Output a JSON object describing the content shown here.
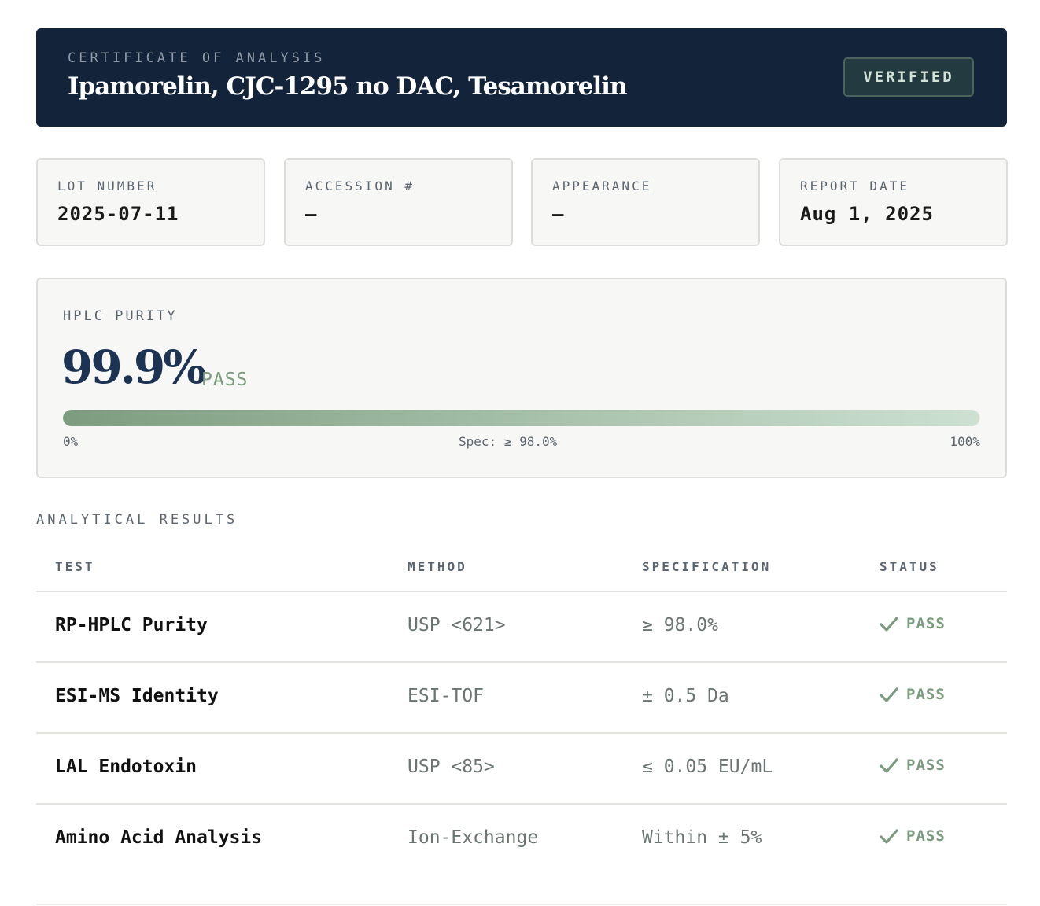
{
  "header": {
    "eyebrow": "CERTIFICATE OF ANALYSIS",
    "title": "Ipamorelin, CJC-1295 no DAC, Tesamorelin",
    "badge": "VERIFIED"
  },
  "summary_cards": [
    {
      "label": "LOT NUMBER",
      "value": "2025-07-11"
    },
    {
      "label": "ACCESSION #",
      "value": "—"
    },
    {
      "label": "APPEARANCE",
      "value": "—"
    },
    {
      "label": "REPORT DATE",
      "value": "Aug 1, 2025"
    }
  ],
  "purity": {
    "label": "HPLC PURITY",
    "value": "99.9%",
    "status": "PASS",
    "fill_percent": 99.9,
    "scale_min": "0%",
    "spec": "Spec: ≥ 98.0%",
    "scale_max": "100%"
  },
  "results": {
    "section_title": "ANALYTICAL RESULTS",
    "columns": [
      "TEST",
      "METHOD",
      "SPECIFICATION",
      "STATUS"
    ],
    "rows": [
      {
        "test": "RP-HPLC Purity",
        "method": "USP <621>",
        "spec": "≥ 98.0%",
        "status": "PASS"
      },
      {
        "test": "ESI-MS Identity",
        "method": "ESI-TOF",
        "spec": "± 0.5 Da",
        "status": "PASS"
      },
      {
        "test": "LAL Endotoxin",
        "method": "USP <85>",
        "spec": "≤ 0.05 EU/mL",
        "status": "PASS"
      },
      {
        "test": "Amino Acid Analysis",
        "method": "Ion-Exchange",
        "spec": "Within ± 5%",
        "status": "PASS"
      }
    ]
  },
  "colors": {
    "header_bg": "#13233a",
    "accent_green": "#7b9b7e",
    "purity_navy": "#1d3354"
  }
}
